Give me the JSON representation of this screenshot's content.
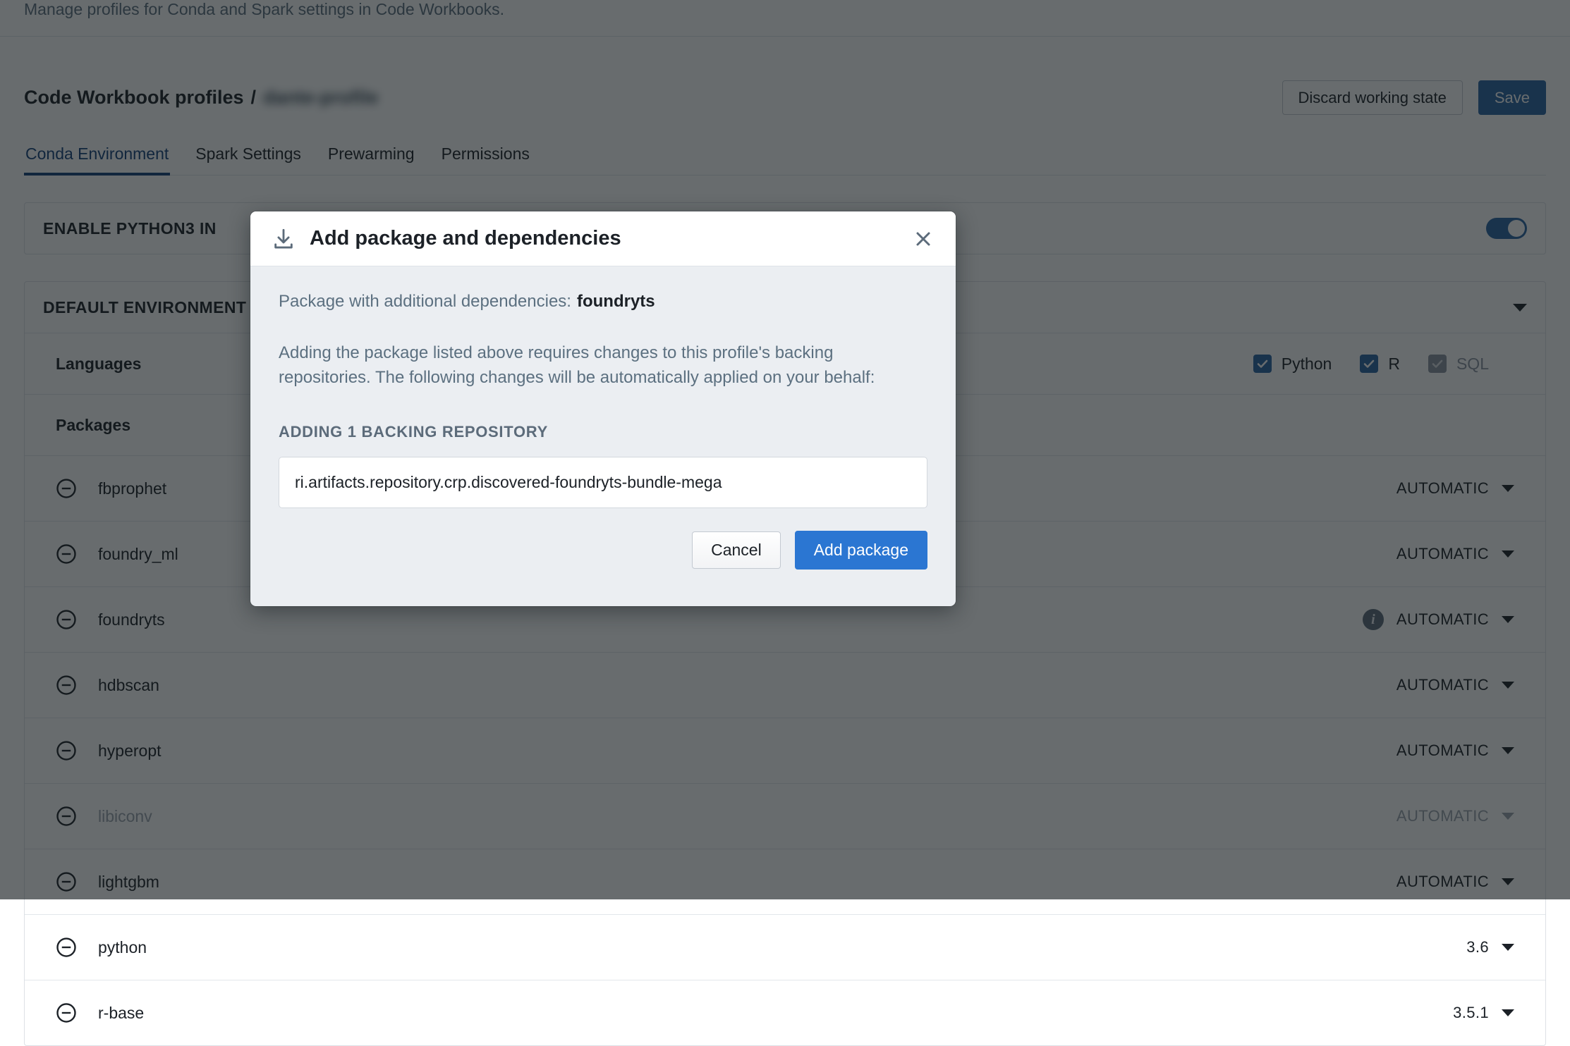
{
  "page": {
    "subtitle": "Manage profiles for Conda and Spark settings in Code Workbooks.",
    "breadcrumb_root": "Code Workbook profiles",
    "breadcrumb_separator": "/",
    "breadcrumb_profile": "dante-profile",
    "discard_label": "Discard working state",
    "save_label": "Save",
    "tabs": [
      {
        "label": "Conda Environment",
        "active": true
      },
      {
        "label": "Spark Settings",
        "active": false
      },
      {
        "label": "Prewarming",
        "active": false
      },
      {
        "label": "Permissions",
        "active": false
      }
    ]
  },
  "python3_panel": {
    "title": "ENABLE PYTHON3 IN",
    "toggle_on": true
  },
  "environment_panel": {
    "title": "DEFAULT ENVIRONMENT",
    "languages_label": "Languages",
    "languages": [
      {
        "label": "Python",
        "checked": true,
        "disabled": false
      },
      {
        "label": "R",
        "checked": true,
        "disabled": false
      },
      {
        "label": "SQL",
        "checked": true,
        "disabled": true
      }
    ],
    "packages_label": "Packages",
    "packages": [
      {
        "name": "fbprophet",
        "version": "AUTOMATIC",
        "info": false,
        "dim": false
      },
      {
        "name": "foundry_ml",
        "version": "AUTOMATIC",
        "info": false,
        "dim": false
      },
      {
        "name": "foundryts",
        "version": "AUTOMATIC",
        "info": true,
        "dim": false
      },
      {
        "name": "hdbscan",
        "version": "AUTOMATIC",
        "info": false,
        "dim": false
      },
      {
        "name": "hyperopt",
        "version": "AUTOMATIC",
        "info": false,
        "dim": false
      },
      {
        "name": "libiconv",
        "version": "AUTOMATIC",
        "info": false,
        "dim": true
      },
      {
        "name": "lightgbm",
        "version": "AUTOMATIC",
        "info": false,
        "dim": false
      },
      {
        "name": "python",
        "version": "3.6",
        "info": false,
        "dim": false
      },
      {
        "name": "r-base",
        "version": "3.5.1",
        "info": false,
        "dim": false
      }
    ]
  },
  "modal": {
    "title": "Add package and dependencies",
    "icon": "download-icon",
    "close_icon": "close-icon",
    "package_line_label": "Package with additional dependencies:",
    "package_name": "foundryts",
    "description": "Adding the package listed above requires changes to this profile's backing repositories. The following changes will be automatically applied on your behalf:",
    "repo_heading": "ADDING 1 BACKING REPOSITORY",
    "repo_value": "ri.artifacts.repository.crp.discovered-foundryts-bundle-mega",
    "cancel_label": "Cancel",
    "confirm_label": "Add package"
  },
  "colors": {
    "accent_blue": "#2b76d2",
    "dark_blue": "#2a64a4",
    "tab_active": "#14417a",
    "muted_text": "#5c7080",
    "modal_bg": "#ebeef2"
  }
}
